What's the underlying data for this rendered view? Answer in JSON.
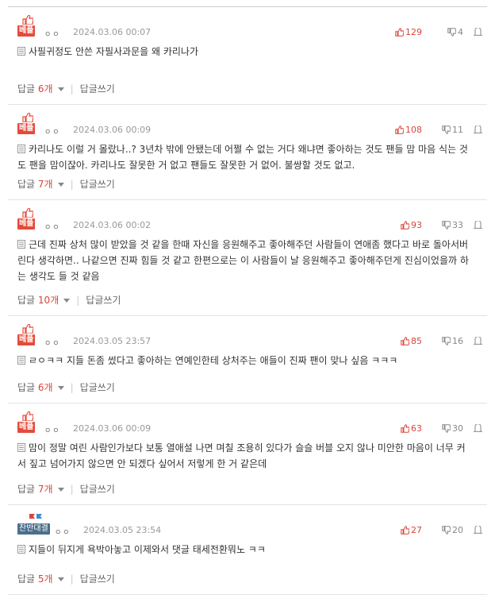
{
  "colors": {
    "accent": "#d9443a",
    "badge_best": "#e44b3b",
    "badge_opp": "#4a6f8a"
  },
  "comments": [
    {
      "badge": "베플",
      "badge_type": "best",
      "user": "ㅇㅇ",
      "date": "2024.03.06 00:07",
      "up": "129",
      "down": "4",
      "text": "사필귀정도 안쓴 자필사과문을 왜 카리나가",
      "reply_label": "답글",
      "reply_count": "6개",
      "write_label": "답글쓰기"
    },
    {
      "badge": "베플",
      "badge_type": "best",
      "user": "ㅇㅇ",
      "date": "2024.03.06 00:09",
      "up": "108",
      "down": "11",
      "text": "카리나도 이럴 거 몰랐나..? 3년차 밖에 안됐는데 어쩔 수 없는 거다 왜냐면 좋아하는 것도 팬들 맘 마음 식는 것도 팬을 맘이잖아. 카리나도 잘못한 거 없고 팬들도 잘못한 거 없어. 불쌍할 것도 없고.",
      "reply_label": "답글",
      "reply_count": "7개",
      "write_label": "답글쓰기"
    },
    {
      "badge": "베플",
      "badge_type": "best",
      "user": "ㅇㅇ",
      "date": "2024.03.06 00:02",
      "up": "93",
      "down": "33",
      "text": "근데 진짜 상처 많이 받았을 것 같을 한때 자신을 응원해주고 좋아해주던 사람들이 연애좀 했다고 바로 돌아서버린다 생각하면.. 나같으면 진짜 힘들 것 같고 한편으로는 이 사람들이 날 응원해주고 좋아해주던게 진심이었을까 하는 생각도 들 것 같음",
      "reply_label": "답글",
      "reply_count": "10개",
      "write_label": "답글쓰기"
    },
    {
      "badge": "베플",
      "badge_type": "best",
      "user": "ㅇㅇ",
      "date": "2024.03.05 23:57",
      "up": "85",
      "down": "16",
      "text": "ㄹㅇㅋㅋ 지들 돈좀 썼다고 좋아하는 연예인한테 상처주는 애들이 진짜 팬이 맞나 싶음 ㅋㅋㅋ",
      "reply_label": "답글",
      "reply_count": "6개",
      "write_label": "답글쓰기"
    },
    {
      "badge": "베플",
      "badge_type": "best",
      "user": "ㅇㅇ",
      "date": "2024.03.06 00:09",
      "up": "63",
      "down": "30",
      "text": "맘이 정말 여린 사람인가보다 보통 열애설 나면 며칠 조용히 있다가 슬슬 버블 오지 않나 미안한 마음이 너무 커서 짚고 넘어가지 않으면 안 되겠다 싶어서 저렇게 한 거 같은데",
      "reply_label": "답글",
      "reply_count": "7개",
      "write_label": "답글쓰기"
    },
    {
      "badge": "찬반대결",
      "badge_type": "opp",
      "user": "ㅇㅇ",
      "date": "2024.03.05 23:54",
      "up": "27",
      "down": "20",
      "text": "지들이 뒤지게 욕박아놓고 이제와서 댓글 태세전환뭐노 ㅋㅋ",
      "reply_label": "답글",
      "reply_count": "5개",
      "write_label": "답글쓰기"
    }
  ]
}
